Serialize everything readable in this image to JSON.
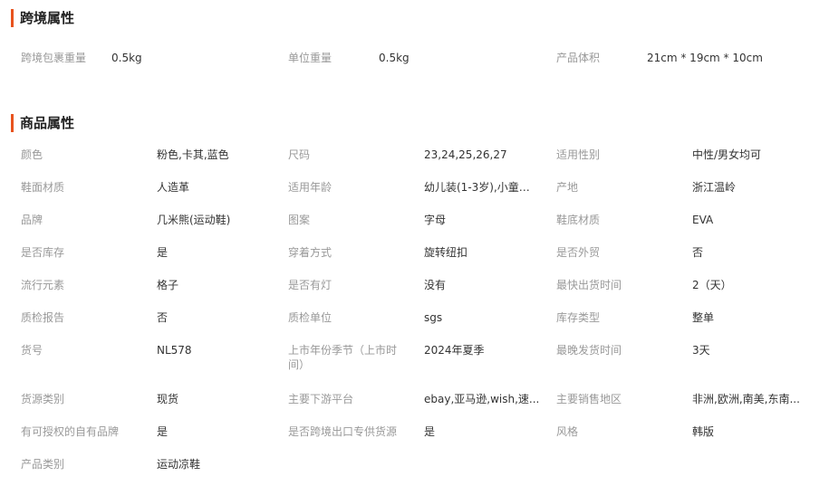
{
  "cross_border": {
    "title": "跨境属性",
    "items": [
      {
        "label": "跨境包裹重量",
        "value": "0.5kg"
      },
      {
        "label": "单位重量",
        "value": "0.5kg"
      },
      {
        "label": "产品体积",
        "value": "21cm * 19cm * 10cm"
      }
    ]
  },
  "product": {
    "title": "商品属性",
    "rows": [
      [
        {
          "label": "颜色",
          "value": "粉色,卡其,蓝色"
        },
        {
          "label": "尺码",
          "value": "23,24,25,26,27"
        },
        {
          "label": "适用性别",
          "value": "中性/男女均可"
        }
      ],
      [
        {
          "label": "鞋面材质",
          "value": "人造革"
        },
        {
          "label": "适用年龄",
          "value": "幼儿装(1-3岁),小童装..."
        },
        {
          "label": "产地",
          "value": "浙江温岭"
        }
      ],
      [
        {
          "label": "品牌",
          "value": "几米熊(运动鞋)"
        },
        {
          "label": "图案",
          "value": "字母"
        },
        {
          "label": "鞋底材质",
          "value": "EVA"
        }
      ],
      [
        {
          "label": "是否库存",
          "value": "是"
        },
        {
          "label": "穿着方式",
          "value": "旋转纽扣"
        },
        {
          "label": "是否外贸",
          "value": "否"
        }
      ],
      [
        {
          "label": "流行元素",
          "value": "格子"
        },
        {
          "label": "是否有灯",
          "value": "没有"
        },
        {
          "label": "最快出货时间",
          "value": "2（天）"
        }
      ],
      [
        {
          "label": "质检报告",
          "value": "否"
        },
        {
          "label": "质检单位",
          "value": "sgs"
        },
        {
          "label": "库存类型",
          "value": "整单"
        }
      ],
      [
        {
          "label": "货号",
          "value": "NL578"
        },
        {
          "label": "上市年份季节（上市时间）",
          "value": "2024年夏季"
        },
        {
          "label": "最晚发货时间",
          "value": "3天"
        }
      ],
      [
        {
          "label": "货源类别",
          "value": "现货"
        },
        {
          "label": "主要下游平台",
          "value": "ebay,亚马逊,wish,速..."
        },
        {
          "label": "主要销售地区",
          "value": "非洲,欧洲,南美,东南..."
        }
      ],
      [
        {
          "label": "有可授权的自有品牌",
          "value": "是"
        },
        {
          "label": "是否跨境出口专供货源",
          "value": "是"
        },
        {
          "label": "风格",
          "value": "韩版"
        }
      ],
      [
        {
          "label": "产品类别",
          "value": "运动凉鞋"
        }
      ]
    ]
  },
  "colors": {
    "accent": "#e8531e",
    "label": "#999999",
    "value": "#333333"
  }
}
